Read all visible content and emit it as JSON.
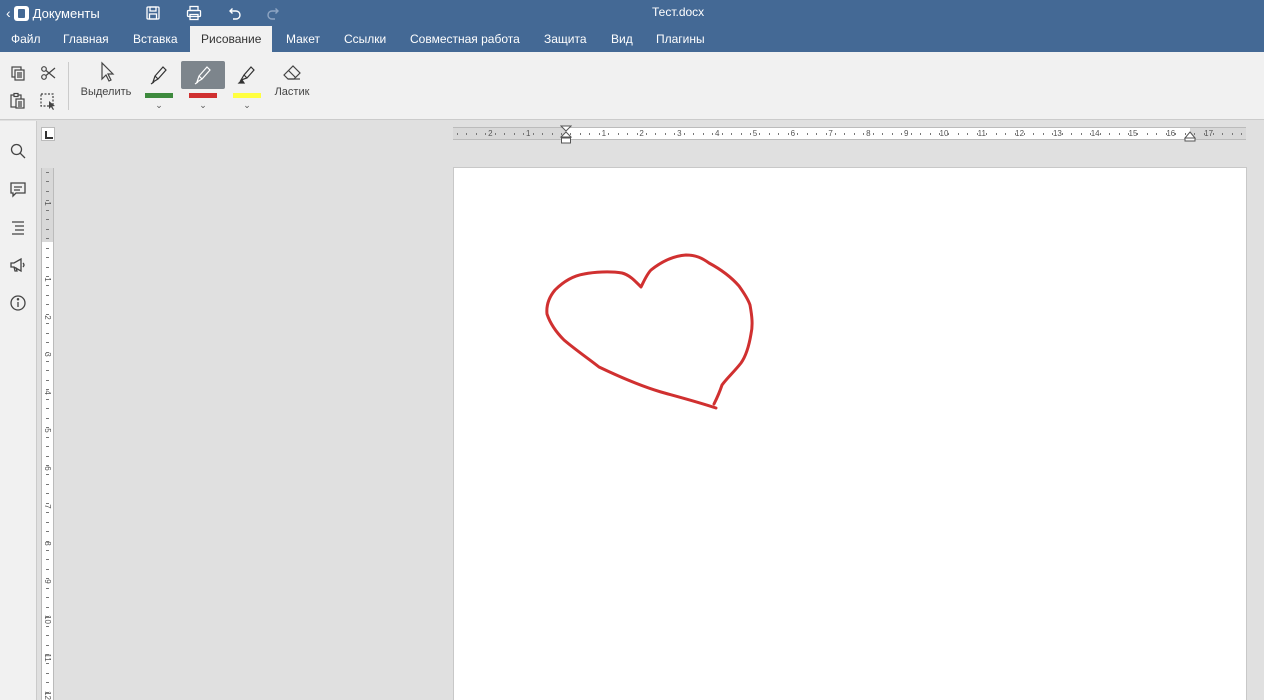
{
  "app": {
    "back_label": "Документы",
    "document_title": "Тест.docx"
  },
  "tabs": [
    {
      "label": "Файл"
    },
    {
      "label": "Главная"
    },
    {
      "label": "Вставка"
    },
    {
      "label": "Рисование",
      "active": true
    },
    {
      "label": "Макет"
    },
    {
      "label": "Ссылки"
    },
    {
      "label": "Совместная работа"
    },
    {
      "label": "Защита"
    },
    {
      "label": "Вид"
    },
    {
      "label": "Плагины"
    }
  ],
  "toolbar": {
    "select_label": "Выделить",
    "eraser_label": "Ластик",
    "pens": [
      {
        "color": "#3d8a3d",
        "selected": false
      },
      {
        "color": "#d03030",
        "selected": true
      },
      {
        "color": "#ffff40",
        "selected": false
      }
    ]
  },
  "ruler": {
    "horizontal_numbers": [
      "2",
      "1",
      "1",
      "2",
      "3",
      "4",
      "5",
      "6",
      "7",
      "8",
      "9",
      "10",
      "11",
      "12",
      "13",
      "14",
      "15",
      "16",
      "17"
    ],
    "vertical_numbers": [
      "1",
      "1",
      "2",
      "3",
      "4",
      "5",
      "6",
      "7",
      "8",
      "9",
      "10",
      "11",
      "12"
    ]
  },
  "drawing": {
    "stroke_color": "#d03030"
  },
  "colors": {
    "header": "#446995",
    "toolbar_bg": "#f1f1f1",
    "workspace_bg": "#e0e0e0"
  }
}
